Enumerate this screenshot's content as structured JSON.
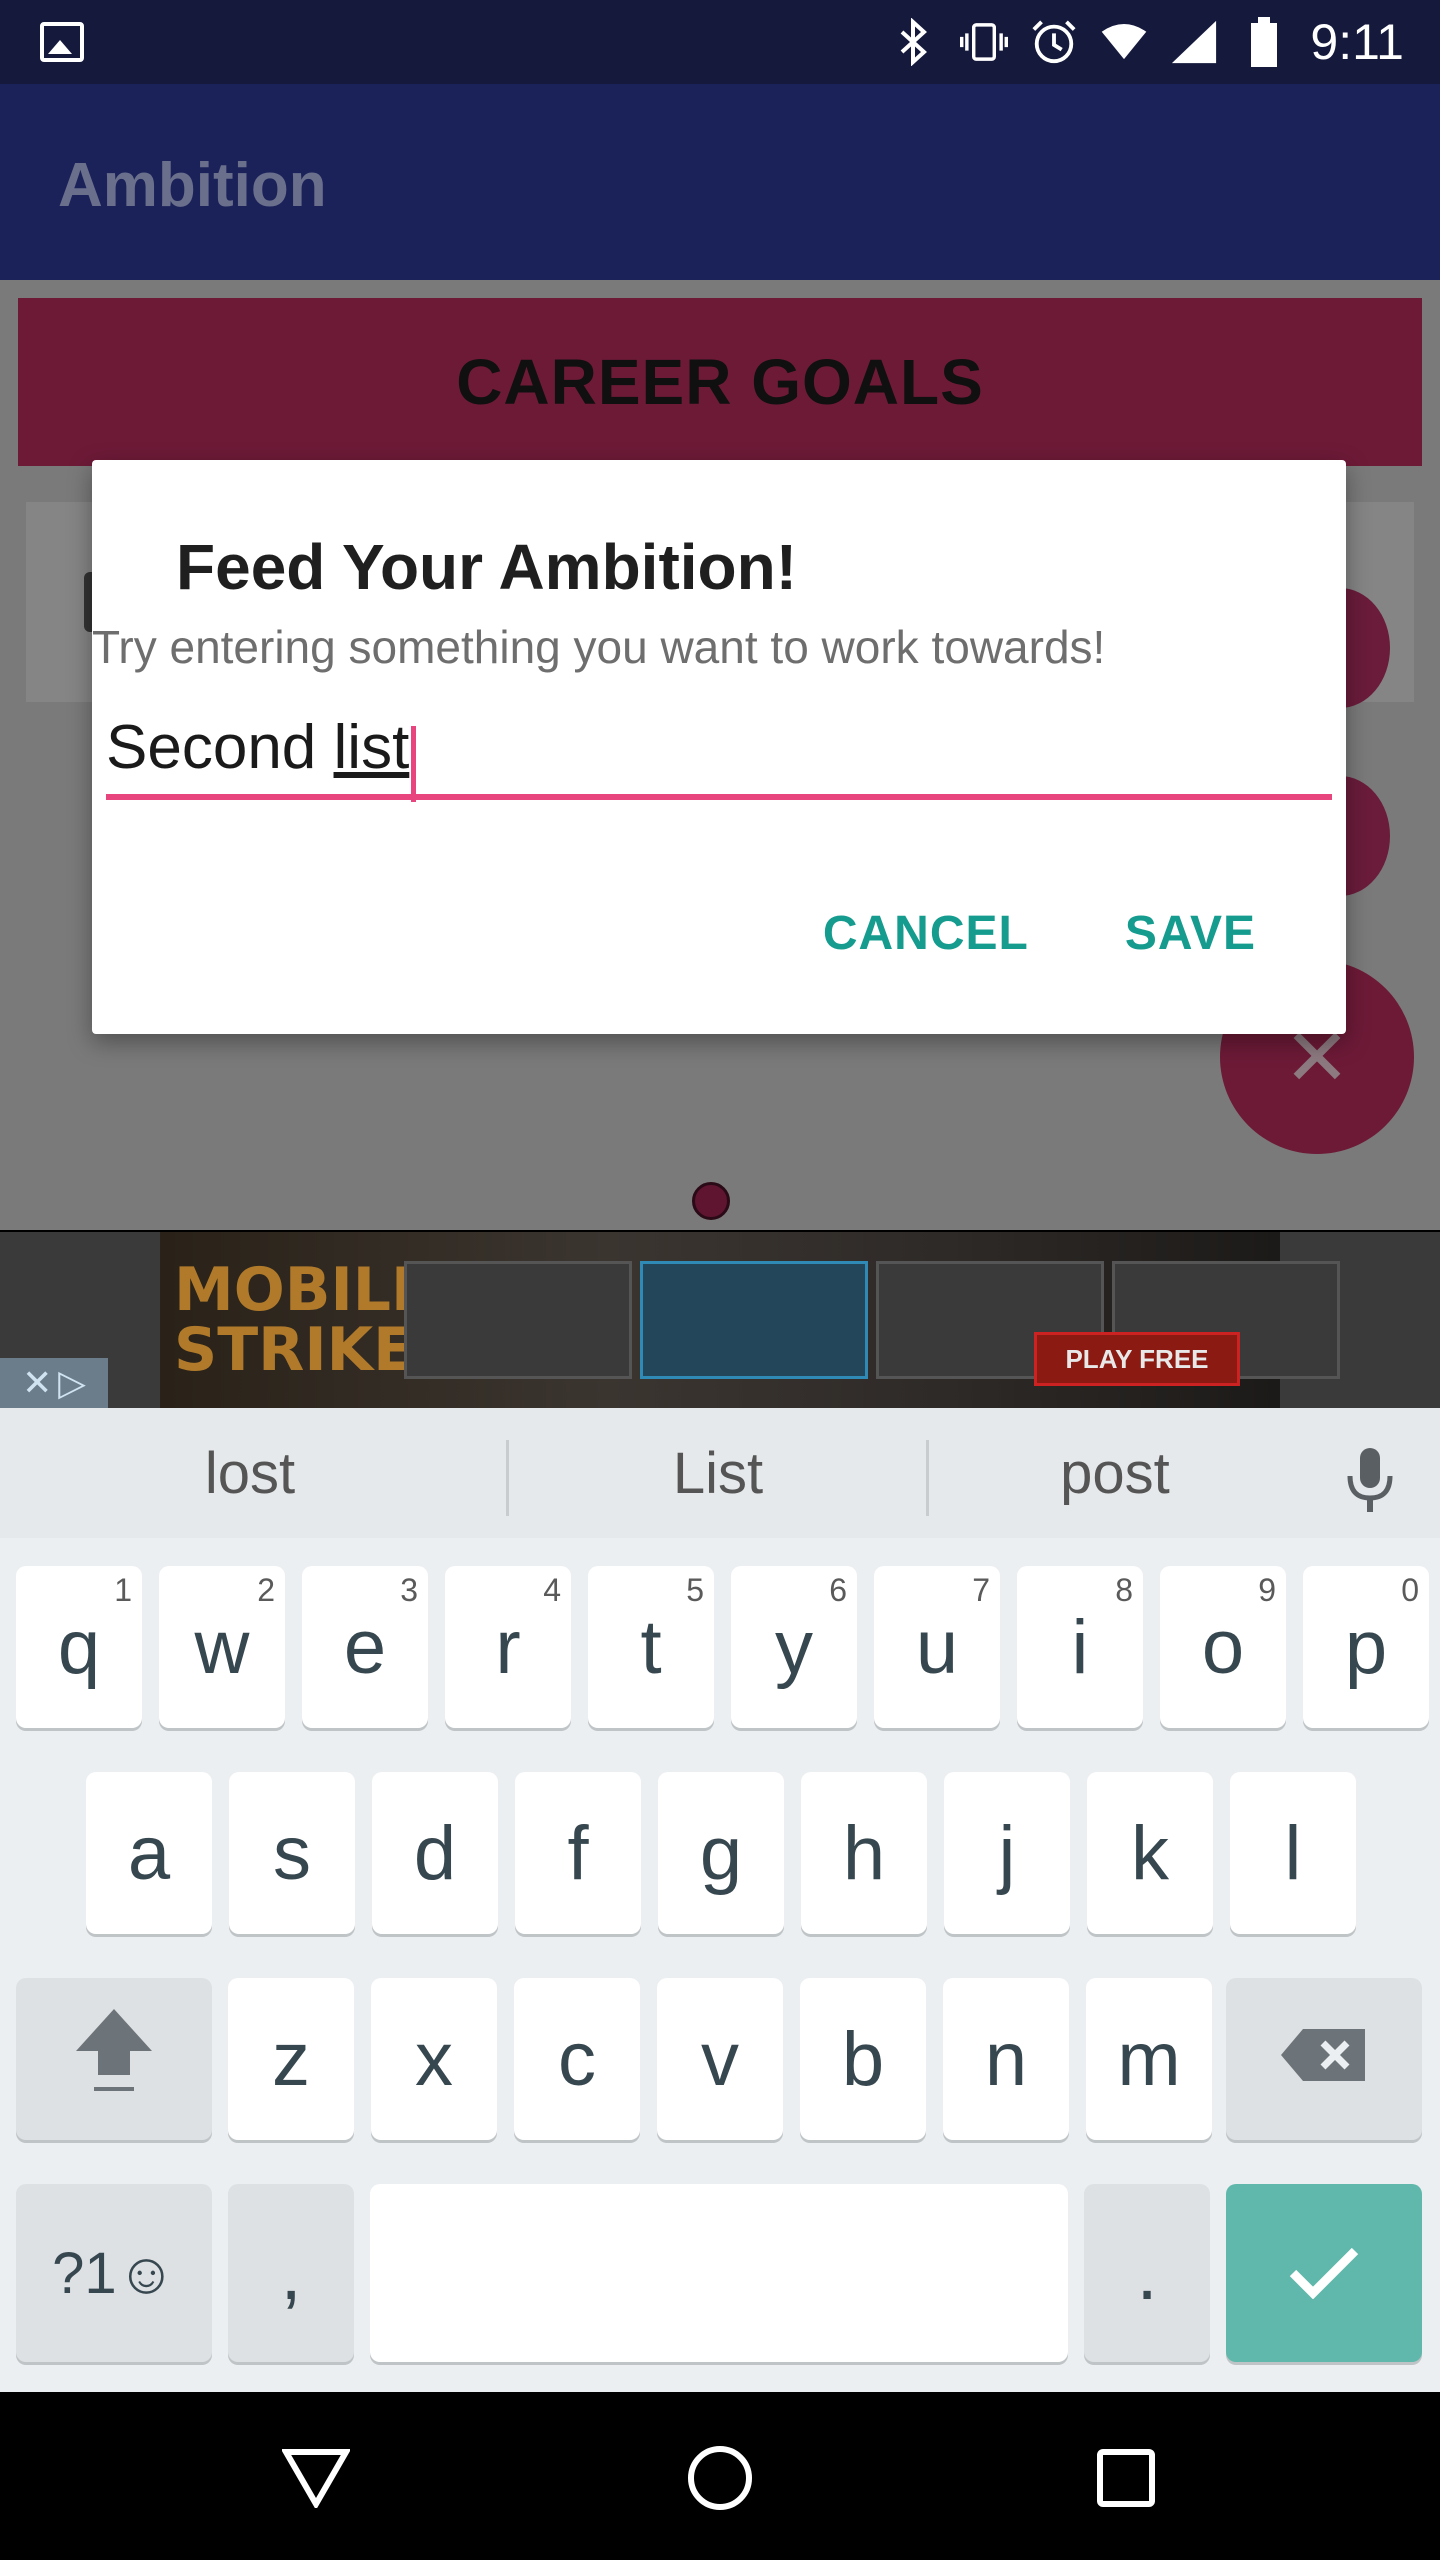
{
  "status_bar": {
    "time": "9:11",
    "icons": [
      "image-icon",
      "bluetooth-icon",
      "vibrate-icon",
      "alarm-icon",
      "wifi-icon",
      "signal-icon",
      "battery-icon"
    ]
  },
  "app": {
    "title": "Ambition",
    "banner": "CAREER GOALS"
  },
  "ad": {
    "logo": "MOBILE STRIKE",
    "cta": "PLAY FREE"
  },
  "dialog": {
    "title": "Feed Your Ambition!",
    "subtitle": "Try entering something you want to work towards!",
    "input_text_plain": "Second ",
    "input_text_underlined": "list",
    "cancel_label": "CANCEL",
    "save_label": "SAVE"
  },
  "keyboard": {
    "suggestions": [
      "lost",
      "List",
      "post"
    ],
    "row1": [
      {
        "k": "q",
        "h": "1"
      },
      {
        "k": "w",
        "h": "2"
      },
      {
        "k": "e",
        "h": "3"
      },
      {
        "k": "r",
        "h": "4"
      },
      {
        "k": "t",
        "h": "5"
      },
      {
        "k": "y",
        "h": "6"
      },
      {
        "k": "u",
        "h": "7"
      },
      {
        "k": "i",
        "h": "8"
      },
      {
        "k": "o",
        "h": "9"
      },
      {
        "k": "p",
        "h": "0"
      }
    ],
    "row2": [
      "a",
      "s",
      "d",
      "f",
      "g",
      "h",
      "j",
      "k",
      "l"
    ],
    "row3": [
      "z",
      "x",
      "c",
      "v",
      "b",
      "n",
      "m"
    ],
    "symbols_label": "?1☺",
    "comma": ",",
    "period": "."
  },
  "colors": {
    "accent_pink": "#e8457f",
    "teal": "#159c8f",
    "app_bar": "#1b225a"
  }
}
